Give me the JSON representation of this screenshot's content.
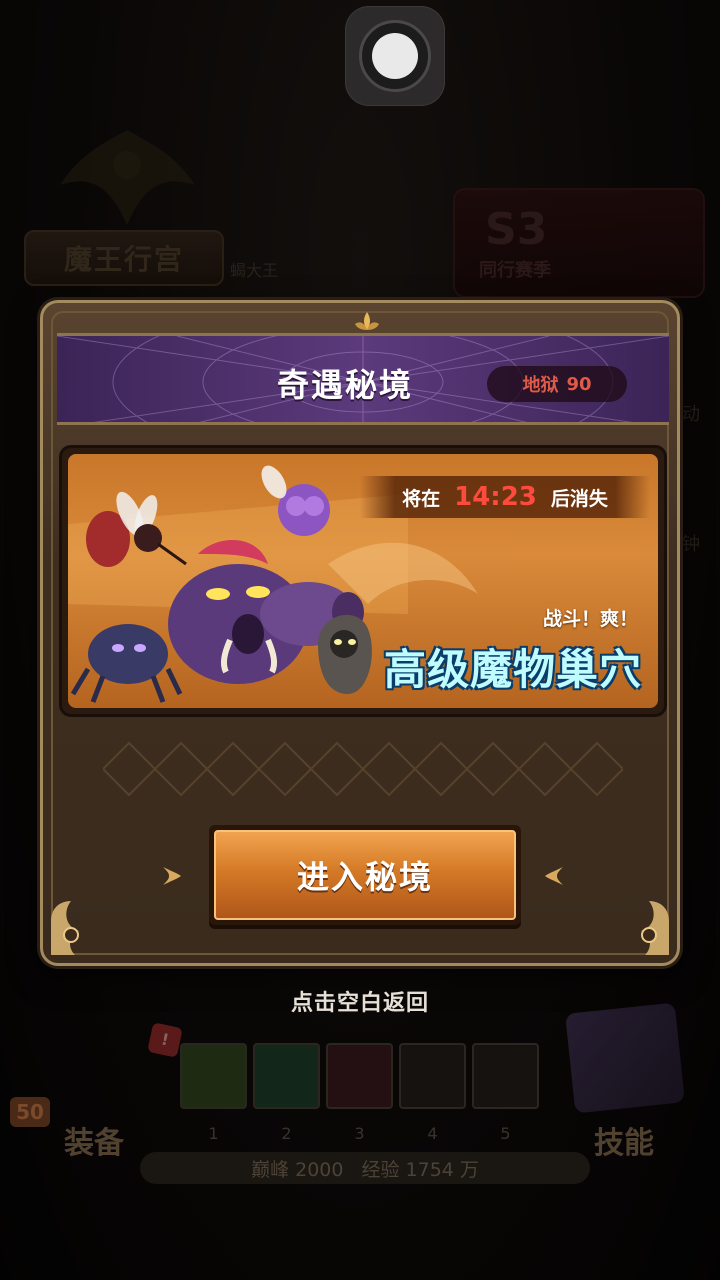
{
  "background": {
    "palace_button": "魔王行宫",
    "sub_name": "蝎大王",
    "season": {
      "code": "S3",
      "name": "同行赛季"
    },
    "side_texts": [
      "动",
      "钟"
    ],
    "bottom": {
      "equip_label": "装备",
      "skill_label": "技能",
      "level_badge": "50",
      "alert": "!",
      "slot_numbers": [
        "1",
        "2",
        "3",
        "4",
        "5"
      ],
      "peak_label": "巅峰 2000",
      "exp_label": "经验 1754 万"
    }
  },
  "modal": {
    "title": "奇遇秘境",
    "difficulty": {
      "label": "地狱",
      "value": "90"
    },
    "banner": {
      "timer_prefix": "将在",
      "timer_value": "14:23",
      "timer_suffix": "后消失",
      "tagline": "战斗！爽！",
      "dungeon_name": "高级魔物巢穴"
    },
    "enter_button": "进入秘境"
  },
  "tap_hint": "点击空白返回",
  "colors": {
    "accent_orange": "#d47a26",
    "timer_red": "#ff4b3e",
    "title_band_purple": "#5c3a7c",
    "dungeon_name_cyan": "#bffcff"
  }
}
